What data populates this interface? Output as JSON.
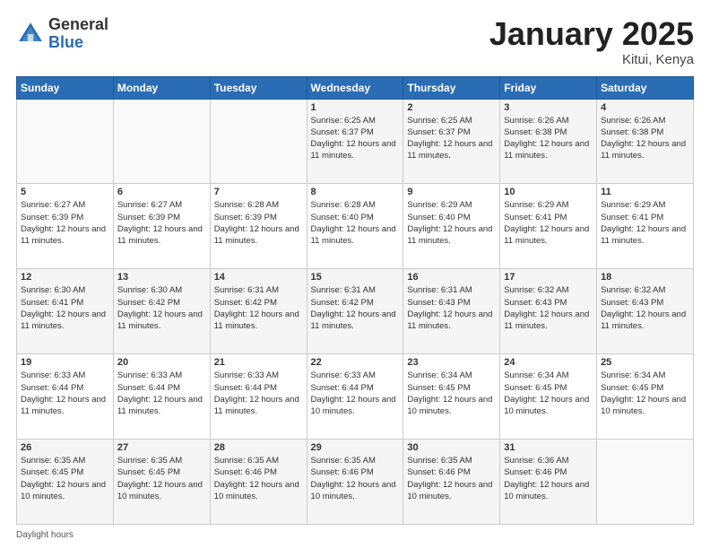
{
  "logo": {
    "general": "General",
    "blue": "Blue"
  },
  "header": {
    "month": "January 2025",
    "location": "Kitui, Kenya"
  },
  "weekdays": [
    "Sunday",
    "Monday",
    "Tuesday",
    "Wednesday",
    "Thursday",
    "Friday",
    "Saturday"
  ],
  "footer": {
    "label": "Daylight hours"
  },
  "weeks": [
    [
      {
        "day": "",
        "sunrise": "",
        "sunset": "",
        "daylight": ""
      },
      {
        "day": "",
        "sunrise": "",
        "sunset": "",
        "daylight": ""
      },
      {
        "day": "",
        "sunrise": "",
        "sunset": "",
        "daylight": ""
      },
      {
        "day": "1",
        "sunrise": "Sunrise: 6:25 AM",
        "sunset": "Sunset: 6:37 PM",
        "daylight": "Daylight: 12 hours and 11 minutes."
      },
      {
        "day": "2",
        "sunrise": "Sunrise: 6:25 AM",
        "sunset": "Sunset: 6:37 PM",
        "daylight": "Daylight: 12 hours and 11 minutes."
      },
      {
        "day": "3",
        "sunrise": "Sunrise: 6:26 AM",
        "sunset": "Sunset: 6:38 PM",
        "daylight": "Daylight: 12 hours and 11 minutes."
      },
      {
        "day": "4",
        "sunrise": "Sunrise: 6:26 AM",
        "sunset": "Sunset: 6:38 PM",
        "daylight": "Daylight: 12 hours and 11 minutes."
      }
    ],
    [
      {
        "day": "5",
        "sunrise": "Sunrise: 6:27 AM",
        "sunset": "Sunset: 6:39 PM",
        "daylight": "Daylight: 12 hours and 11 minutes."
      },
      {
        "day": "6",
        "sunrise": "Sunrise: 6:27 AM",
        "sunset": "Sunset: 6:39 PM",
        "daylight": "Daylight: 12 hours and 11 minutes."
      },
      {
        "day": "7",
        "sunrise": "Sunrise: 6:28 AM",
        "sunset": "Sunset: 6:39 PM",
        "daylight": "Daylight: 12 hours and 11 minutes."
      },
      {
        "day": "8",
        "sunrise": "Sunrise: 6:28 AM",
        "sunset": "Sunset: 6:40 PM",
        "daylight": "Daylight: 12 hours and 11 minutes."
      },
      {
        "day": "9",
        "sunrise": "Sunrise: 6:29 AM",
        "sunset": "Sunset: 6:40 PM",
        "daylight": "Daylight: 12 hours and 11 minutes."
      },
      {
        "day": "10",
        "sunrise": "Sunrise: 6:29 AM",
        "sunset": "Sunset: 6:41 PM",
        "daylight": "Daylight: 12 hours and 11 minutes."
      },
      {
        "day": "11",
        "sunrise": "Sunrise: 6:29 AM",
        "sunset": "Sunset: 6:41 PM",
        "daylight": "Daylight: 12 hours and 11 minutes."
      }
    ],
    [
      {
        "day": "12",
        "sunrise": "Sunrise: 6:30 AM",
        "sunset": "Sunset: 6:41 PM",
        "daylight": "Daylight: 12 hours and 11 minutes."
      },
      {
        "day": "13",
        "sunrise": "Sunrise: 6:30 AM",
        "sunset": "Sunset: 6:42 PM",
        "daylight": "Daylight: 12 hours and 11 minutes."
      },
      {
        "day": "14",
        "sunrise": "Sunrise: 6:31 AM",
        "sunset": "Sunset: 6:42 PM",
        "daylight": "Daylight: 12 hours and 11 minutes."
      },
      {
        "day": "15",
        "sunrise": "Sunrise: 6:31 AM",
        "sunset": "Sunset: 6:42 PM",
        "daylight": "Daylight: 12 hours and 11 minutes."
      },
      {
        "day": "16",
        "sunrise": "Sunrise: 6:31 AM",
        "sunset": "Sunset: 6:43 PM",
        "daylight": "Daylight: 12 hours and 11 minutes."
      },
      {
        "day": "17",
        "sunrise": "Sunrise: 6:32 AM",
        "sunset": "Sunset: 6:43 PM",
        "daylight": "Daylight: 12 hours and 11 minutes."
      },
      {
        "day": "18",
        "sunrise": "Sunrise: 6:32 AM",
        "sunset": "Sunset: 6:43 PM",
        "daylight": "Daylight: 12 hours and 11 minutes."
      }
    ],
    [
      {
        "day": "19",
        "sunrise": "Sunrise: 6:33 AM",
        "sunset": "Sunset: 6:44 PM",
        "daylight": "Daylight: 12 hours and 11 minutes."
      },
      {
        "day": "20",
        "sunrise": "Sunrise: 6:33 AM",
        "sunset": "Sunset: 6:44 PM",
        "daylight": "Daylight: 12 hours and 11 minutes."
      },
      {
        "day": "21",
        "sunrise": "Sunrise: 6:33 AM",
        "sunset": "Sunset: 6:44 PM",
        "daylight": "Daylight: 12 hours and 11 minutes."
      },
      {
        "day": "22",
        "sunrise": "Sunrise: 6:33 AM",
        "sunset": "Sunset: 6:44 PM",
        "daylight": "Daylight: 12 hours and 10 minutes."
      },
      {
        "day": "23",
        "sunrise": "Sunrise: 6:34 AM",
        "sunset": "Sunset: 6:45 PM",
        "daylight": "Daylight: 12 hours and 10 minutes."
      },
      {
        "day": "24",
        "sunrise": "Sunrise: 6:34 AM",
        "sunset": "Sunset: 6:45 PM",
        "daylight": "Daylight: 12 hours and 10 minutes."
      },
      {
        "day": "25",
        "sunrise": "Sunrise: 6:34 AM",
        "sunset": "Sunset: 6:45 PM",
        "daylight": "Daylight: 12 hours and 10 minutes."
      }
    ],
    [
      {
        "day": "26",
        "sunrise": "Sunrise: 6:35 AM",
        "sunset": "Sunset: 6:45 PM",
        "daylight": "Daylight: 12 hours and 10 minutes."
      },
      {
        "day": "27",
        "sunrise": "Sunrise: 6:35 AM",
        "sunset": "Sunset: 6:45 PM",
        "daylight": "Daylight: 12 hours and 10 minutes."
      },
      {
        "day": "28",
        "sunrise": "Sunrise: 6:35 AM",
        "sunset": "Sunset: 6:46 PM",
        "daylight": "Daylight: 12 hours and 10 minutes."
      },
      {
        "day": "29",
        "sunrise": "Sunrise: 6:35 AM",
        "sunset": "Sunset: 6:46 PM",
        "daylight": "Daylight: 12 hours and 10 minutes."
      },
      {
        "day": "30",
        "sunrise": "Sunrise: 6:35 AM",
        "sunset": "Sunset: 6:46 PM",
        "daylight": "Daylight: 12 hours and 10 minutes."
      },
      {
        "day": "31",
        "sunrise": "Sunrise: 6:36 AM",
        "sunset": "Sunset: 6:46 PM",
        "daylight": "Daylight: 12 hours and 10 minutes."
      },
      {
        "day": "",
        "sunrise": "",
        "sunset": "",
        "daylight": ""
      }
    ]
  ]
}
